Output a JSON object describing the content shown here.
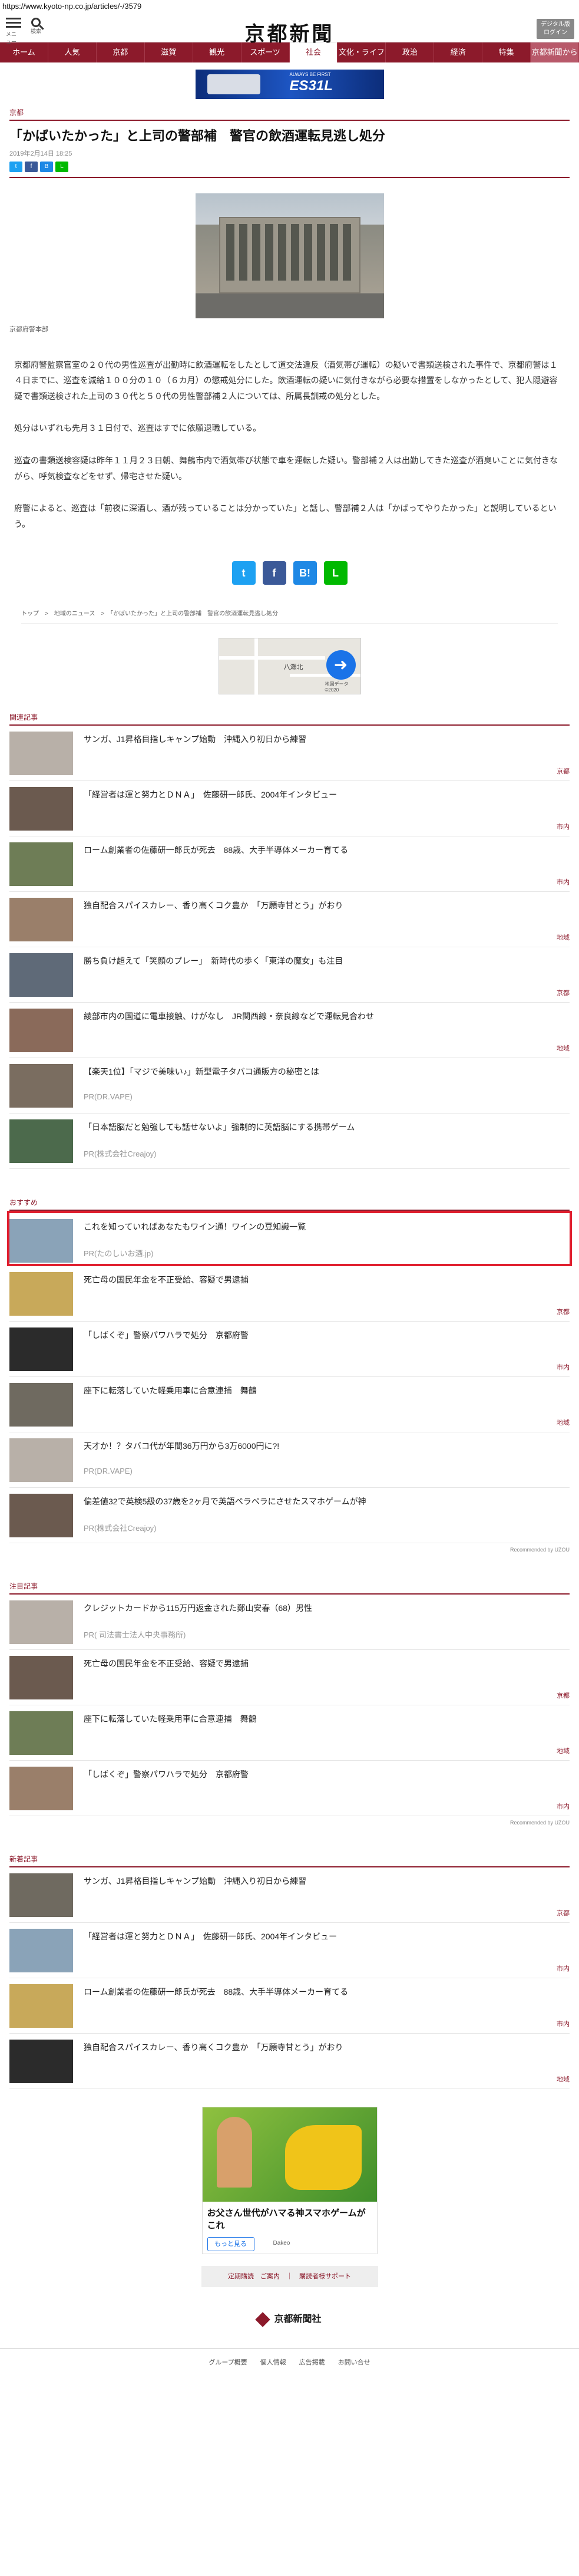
{
  "url": "https://www.kyoto-np.co.jp/articles/-/3579",
  "header": {
    "menu_label": "メニュー",
    "search_label": "検索",
    "logo": "京都新聞",
    "login_label": "デジタル版\nログイン"
  },
  "nav": [
    "ホーム",
    "人気",
    "京都",
    "滋賀",
    "観光",
    "スポーツ",
    "社会",
    "文化・ライフ",
    "政治",
    "経済",
    "特集",
    "京都新聞から"
  ],
  "ad_top": {
    "sub": "ALWAYS BE FIRST",
    "product": "ES31L"
  },
  "article": {
    "section": "京都",
    "title": "「かばいたかった」と上司の警部補　警官の飲酒運転見逃し処分",
    "date": "2019年2月14日 18:25",
    "photo_caption": "京都府警本部",
    "paragraphs": [
      "京都府警監察官室の２０代の男性巡査が出勤時に飲酒運転をしたとして道交法違反（酒気帯び運転）の疑いで書類送検された事件で、京都府警は１４日までに、巡査を減給１００分の１０（６カ月）の懲戒処分にした。飲酒運転の疑いに気付きながら必要な措置をしなかったとして、犯人隠避容疑で書類送検された上司の３０代と５０代の男性警部補２人については、所属長訓戒の処分とした。",
      "処分はいずれも先月３１日付で、巡査はすでに依願退職している。",
      "巡査の書類送検容疑は昨年１１月２３日朝、舞鶴市内で酒気帯び状態で車を運転した疑い。警部補２人は出勤してきた巡査が酒臭いことに気付きながら、呼気検査などをせず、帰宅させた疑い。",
      "府警によると、巡査は「前夜に深酒し、酒が残っていることは分かっていた」と話し、警部補２人は「かばってやりたかった」と説明しているという。"
    ],
    "breadcrumb": "トップ　>　地域のニュース　>　「かばいたかった」と上司の警部補　警官の飲酒運転見逃し処分",
    "map_label": "八瀬北",
    "map_footer": "地図データ ©2020"
  },
  "related": {
    "label": "関連記事",
    "items": [
      {
        "title": "サンガ、J1昇格目指しキャンプ始動　沖縄入り初日から練習",
        "cat": "京都",
        "pr": ""
      },
      {
        "title": "「経営者は運と努力とＤＮＡ」　佐藤研一郎氏、2004年インタビュー",
        "cat": "市内",
        "pr": ""
      },
      {
        "title": "ローム創業者の佐藤研一郎氏が死去　88歳、大手半導体メーカー育てる",
        "cat": "市内",
        "pr": ""
      },
      {
        "title": "独自配合スパイスカレー、香り高くコク豊か　「万願寺甘とう」がおり",
        "cat": "地域",
        "pr": ""
      },
      {
        "title": "勝ち負け超えて「笑顔のプレー」　新時代の歩く「東洋の魔女」も注目",
        "cat": "京都",
        "pr": ""
      },
      {
        "title": "綾部市内の国道に電車接触、けがなし　JR関西線・奈良線などで運転見合わせ",
        "cat": "地域",
        "pr": ""
      },
      {
        "title": "【楽天1位】「マジで美味い♪」新型電子タバコ通販方の秘密とは",
        "cat": "",
        "pr": "PR(DR.VAPE)"
      },
      {
        "title": "「日本語脳だと勉強しても話せないよ」強制的に英語脳にする携帯ゲーム",
        "cat": "",
        "pr": "PR(株式会社Creajoy)"
      }
    ]
  },
  "recommend": {
    "label": "おすすめ",
    "items": [
      {
        "title": "これを知っていればあなたもワイン通！ワインの豆知識一覧",
        "cat": "",
        "pr": "PR(たのしいお酒.jp)"
      },
      {
        "title": "死亡母の国民年金を不正受給、容疑で男逮捕",
        "cat": "京都",
        "pr": ""
      },
      {
        "title": "「しばくぞ」警察パワハラで処分　京都府警",
        "cat": "市内",
        "pr": ""
      },
      {
        "title": "座下に転落していた軽乗用車に合意連捕　舞鶴",
        "cat": "地域",
        "pr": ""
      },
      {
        "title": "天才か！？タバコ代が年間36万円から3万6000円に?!",
        "cat": "",
        "pr": "PR(DR.VAPE)"
      },
      {
        "title": "偏差値32で英検5級の37歳を2ヶ月で英語ペラペラにさせたスマホゲームが神",
        "cat": "",
        "pr": "PR(株式会社Creajoy)"
      }
    ],
    "recommended_by": "Recommended by UZOU"
  },
  "notable": {
    "label": "注目記事",
    "items": [
      {
        "title": "クレジットカードから115万円返金された鄭山安春（68）男性",
        "cat": "",
        "pr": "PR( 司法書士法人中央事務所)"
      },
      {
        "title": "死亡母の国民年金を不正受給、容疑で男逮捕",
        "cat": "京都",
        "pr": ""
      },
      {
        "title": "座下に転落していた軽乗用車に合意連捕　舞鶴",
        "cat": "地域",
        "pr": ""
      },
      {
        "title": "「しばくぞ」警察パワハラで処分　京都府警",
        "cat": "市内",
        "pr": ""
      }
    ],
    "recommended_by": "Recommended by UZOU"
  },
  "latest": {
    "label": "新着記事",
    "items": [
      {
        "title": "サンガ、J1昇格目指しキャンプ始動　沖縄入り初日から練習",
        "cat": "京都",
        "pr": ""
      },
      {
        "title": "「経営者は運と努力とＤＮＡ」　佐藤研一郎氏、2004年インタビュー",
        "cat": "市内",
        "pr": ""
      },
      {
        "title": "ローム創業者の佐藤研一郎氏が死去　88歳、大手半導体メーカー育てる",
        "cat": "市内",
        "pr": ""
      },
      {
        "title": "独自配合スパイスカレー、香り高くコク豊か　「万願寺甘とう」がおり",
        "cat": "地域",
        "pr": ""
      }
    ]
  },
  "bottom_ad": {
    "title": "お父さん世代がハマる神スマホゲームがこれ",
    "cta": "もっと見る",
    "source": "Dakeo"
  },
  "footer_bar": "定期購読　ご案内　｜　購読者様サポート",
  "footer_logo": "京都新聞社",
  "footer_links": [
    "グループ概要",
    "個人情報",
    "広告掲載",
    "お問い合せ"
  ]
}
